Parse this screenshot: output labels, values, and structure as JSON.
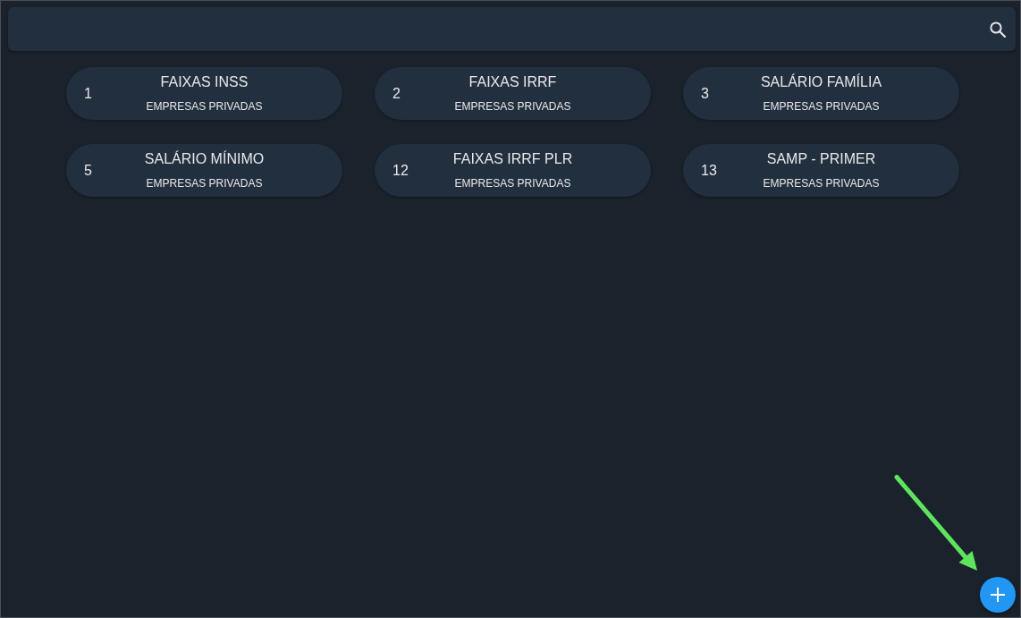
{
  "cards": [
    {
      "number": "1",
      "title": "FAIXAS INSS",
      "subtitle": "EMPRESAS PRIVADAS"
    },
    {
      "number": "2",
      "title": "FAIXAS IRRF",
      "subtitle": "EMPRESAS PRIVADAS"
    },
    {
      "number": "3",
      "title": "SALÁRIO FAMÍLIA",
      "subtitle": "EMPRESAS PRIVADAS"
    },
    {
      "number": "5",
      "title": "SALÁRIO MÍNIMO",
      "subtitle": "EMPRESAS PRIVADAS"
    },
    {
      "number": "12",
      "title": "FAIXAS IRRF PLR",
      "subtitle": "EMPRESAS PRIVADAS"
    },
    {
      "number": "13",
      "title": "SAMP - PRIMER",
      "subtitle": "EMPRESAS PRIVADAS"
    }
  ]
}
